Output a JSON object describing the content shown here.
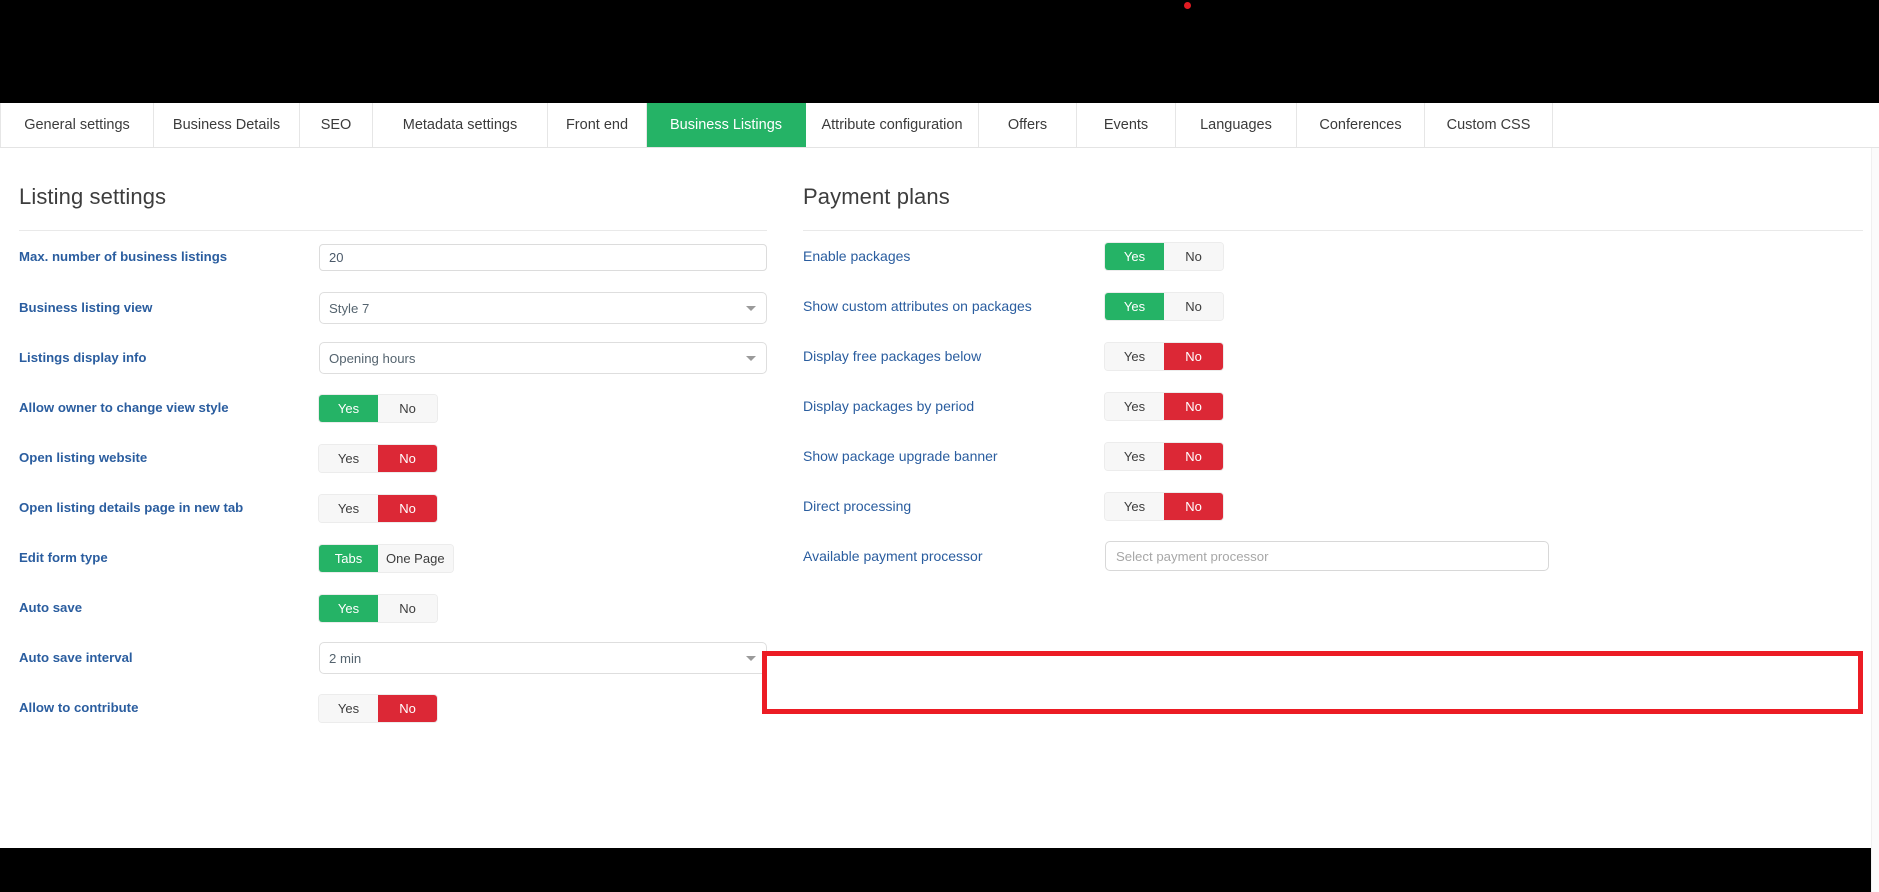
{
  "window": {
    "cursor_marker": "red-dot"
  },
  "tabs": [
    {
      "label": "General settings",
      "active": false
    },
    {
      "label": "Business Details",
      "active": false
    },
    {
      "label": "SEO",
      "active": false
    },
    {
      "label": "Metadata settings",
      "active": false
    },
    {
      "label": "Front end",
      "active": false
    },
    {
      "label": "Business Listings",
      "active": true
    },
    {
      "label": "Attribute configuration",
      "active": false
    },
    {
      "label": "Offers",
      "active": false
    },
    {
      "label": "Events",
      "active": false
    },
    {
      "label": "Languages",
      "active": false
    },
    {
      "label": "Conferences",
      "active": false
    },
    {
      "label": "Custom CSS",
      "active": false
    }
  ],
  "left_panel": {
    "title": "Listing settings",
    "rows": [
      {
        "label": "Max. number of business listings",
        "control": "text",
        "value": "20"
      },
      {
        "label": "Business listing view",
        "control": "select",
        "value": "Style 7"
      },
      {
        "label": "Listings display info",
        "control": "select",
        "value": "Opening hours"
      },
      {
        "label": "Allow owner to change view style",
        "control": "toggle",
        "options": [
          "Yes",
          "No"
        ],
        "selected": "Yes"
      },
      {
        "label": "Open listing website",
        "control": "toggle",
        "options": [
          "Yes",
          "No"
        ],
        "selected": "No"
      },
      {
        "label": "Open listing details page in new tab",
        "control": "toggle",
        "options": [
          "Yes",
          "No"
        ],
        "selected": "No"
      },
      {
        "label": "Edit form type",
        "control": "toggle",
        "options": [
          "Tabs",
          "One Page"
        ],
        "selected": "Tabs"
      },
      {
        "label": "Auto save",
        "control": "toggle",
        "options": [
          "Yes",
          "No"
        ],
        "selected": "Yes"
      },
      {
        "label": "Auto save interval",
        "control": "select",
        "value": "2 min"
      },
      {
        "label": "Allow to contribute",
        "control": "toggle",
        "options": [
          "Yes",
          "No"
        ],
        "selected": "No"
      }
    ]
  },
  "right_panel": {
    "title": "Payment plans",
    "rows": [
      {
        "label": "Enable packages",
        "control": "toggle",
        "options": [
          "Yes",
          "No"
        ],
        "selected": "Yes"
      },
      {
        "label": "Show custom attributes on packages",
        "control": "toggle",
        "options": [
          "Yes",
          "No"
        ],
        "selected": "Yes"
      },
      {
        "label": "Display free packages below",
        "control": "toggle",
        "options": [
          "Yes",
          "No"
        ],
        "selected": "No"
      },
      {
        "label": "Display packages by period",
        "control": "toggle",
        "options": [
          "Yes",
          "No"
        ],
        "selected": "No"
      },
      {
        "label": "Show package upgrade banner",
        "control": "toggle",
        "options": [
          "Yes",
          "No"
        ],
        "selected": "No"
      },
      {
        "label": "Direct processing",
        "control": "toggle",
        "options": [
          "Yes",
          "No"
        ],
        "selected": "No"
      },
      {
        "label": "Available payment processor",
        "control": "select2",
        "value": "",
        "placeholder": "Select payment processor",
        "highlighted": true
      }
    ]
  },
  "colors": {
    "accent_green": "#25b366",
    "accent_red": "#dc2836",
    "label_blue": "#2a5d9f",
    "highlight_red": "#ec1c24",
    "toggle_off_bg": "#f7f7f7"
  }
}
